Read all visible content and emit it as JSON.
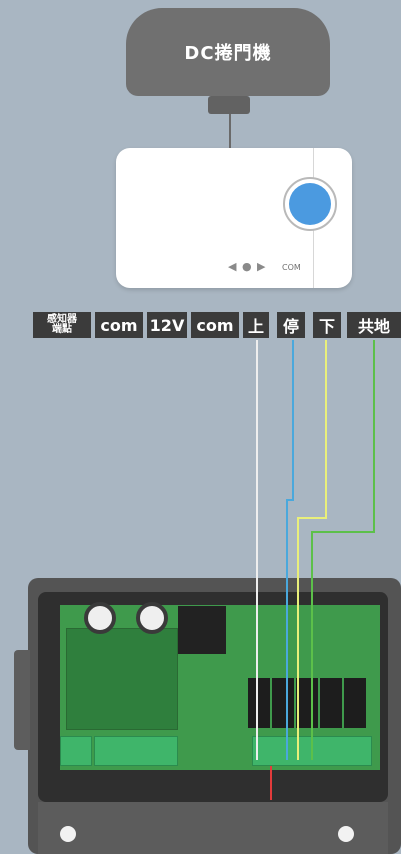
{
  "motor": {
    "label": "DC捲門機"
  },
  "controller": {
    "indicators": "◀ ● ▶",
    "com_label": "COM",
    "button_color": "#4b9ae0"
  },
  "terminals": [
    {
      "id": "sensor",
      "label": "感知器端點"
    },
    {
      "id": "com1",
      "label": "com"
    },
    {
      "id": "v12",
      "label": "12V"
    },
    {
      "id": "com2",
      "label": "com"
    },
    {
      "id": "up",
      "label": "上"
    },
    {
      "id": "stop",
      "label": "停"
    },
    {
      "id": "down",
      "label": "下"
    },
    {
      "id": "gnd",
      "label": "共地"
    }
  ],
  "wire_colors": {
    "up": "#eeeeee",
    "stop": "#4aa8dc",
    "down": "#e9ef7a",
    "gnd": "#5cc04a",
    "extra": "#e23b3b"
  }
}
